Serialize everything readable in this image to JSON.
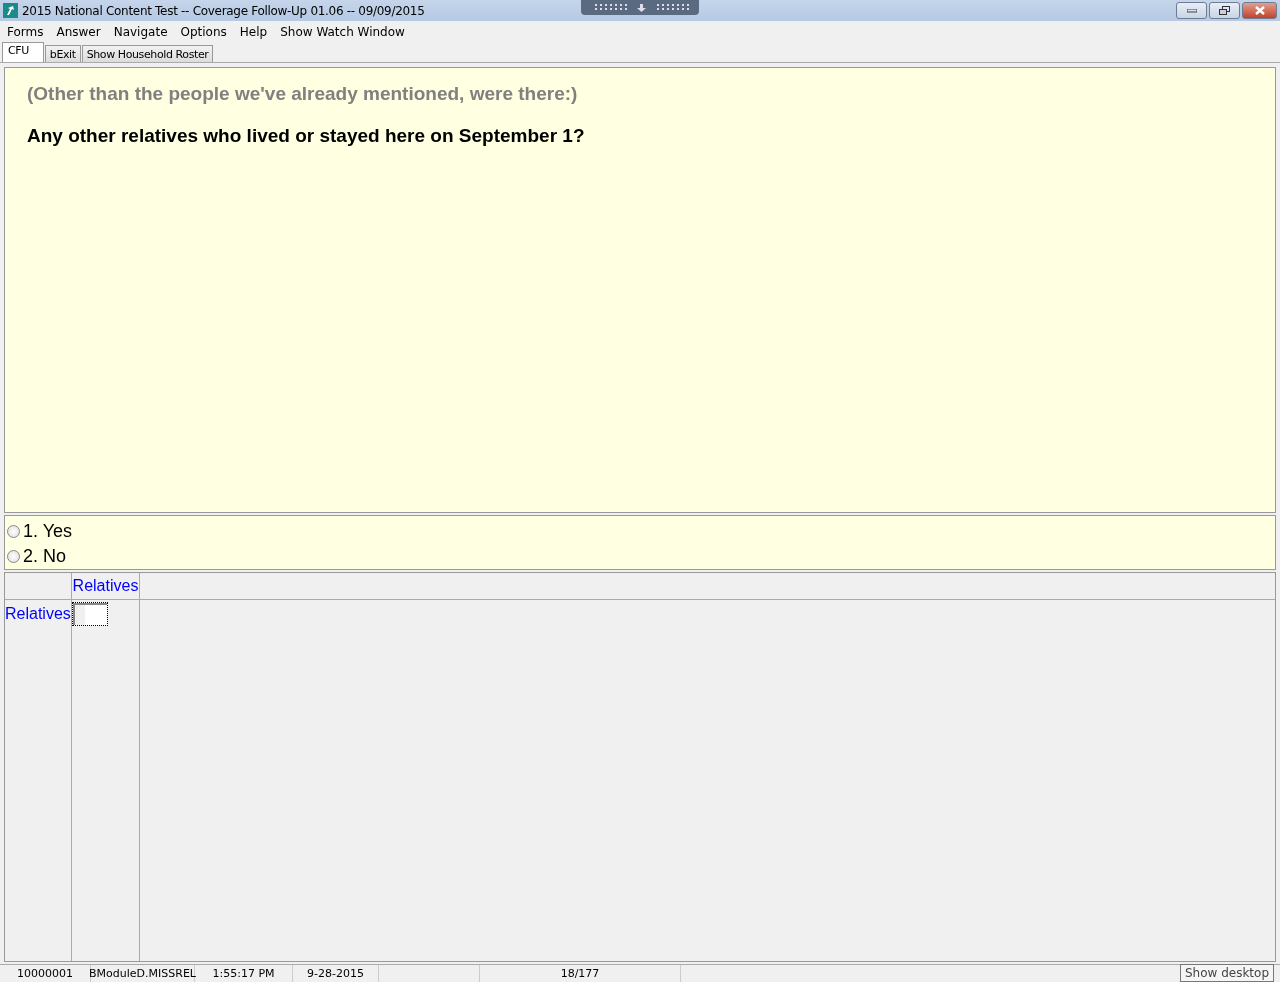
{
  "window": {
    "title": "2015 National Content Test -- Coverage Follow-Up 01.06 -- 09/09/2015"
  },
  "menu": [
    "Forms",
    "Answer",
    "Navigate",
    "Options",
    "Help",
    "Show Watch Window"
  ],
  "tabs": [
    {
      "label": "CFU",
      "selected": true
    },
    {
      "label": "bExit",
      "selected": false
    },
    {
      "label": "Show Household Roster",
      "selected": false
    }
  ],
  "question": {
    "preamble": "(Other than the people we've already mentioned, were there:)",
    "text": "Any other relatives who lived or stayed here on September 1?"
  },
  "answers": [
    {
      "label": "1. Yes",
      "selected": false
    },
    {
      "label": "2. No",
      "selected": false
    }
  ],
  "grid": {
    "column_header": "Relatives",
    "row_header": "Relatives"
  },
  "status_bar": [
    "10000001",
    "BModuleD.MISSREL",
    "1:55:17 PM",
    "9-28-2015",
    "18/177"
  ],
  "tooltip": "Show desktop"
}
